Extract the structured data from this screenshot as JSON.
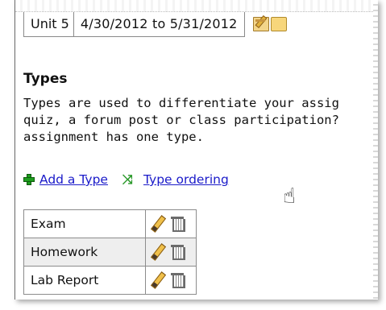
{
  "unit": {
    "name": "Unit 5",
    "date_range": "4/30/2012  to 5/31/2012",
    "icons": [
      "calendar-edit-icon",
      "folder-icon"
    ]
  },
  "types_section": {
    "title": "Types",
    "description": "Types are used to differentiate your assig\nquiz, a forum post or class participation? \nassignment has one type."
  },
  "actions": {
    "add_type": "Add a Type",
    "type_ordering": "Type ordering"
  },
  "types_table": {
    "rows": [
      {
        "name": "Exam"
      },
      {
        "name": "Homework"
      },
      {
        "name": "Lab Report"
      }
    ]
  },
  "colors": {
    "link": "#1a1ac9",
    "add_icon": "#1f9d1f",
    "row_alt": "#eeeeee"
  }
}
